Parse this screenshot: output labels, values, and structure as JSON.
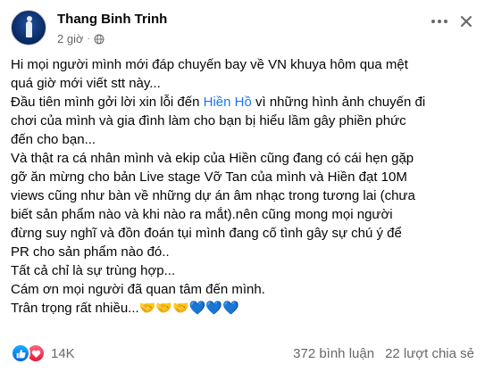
{
  "post": {
    "author": "Thang Binh Trinh",
    "time": "2 giờ",
    "separator": "·",
    "audience_icon": "globe-icon",
    "more_icon": "more-horizontal-icon",
    "close_icon": "close-icon",
    "lines": {
      "l1": "Hi mọi người mình mới đáp chuyến bay về VN khuya hôm qua mệt",
      "l2": "quá giờ mới viết stt này...",
      "l3a": "Đầu tiên mình gởi lời xin lỗi đến ",
      "mention": "Hiền Hồ",
      "l3b": " vì những hình ảnh chuyến đi",
      "l4": "chơi của mình và gia đình làm cho bạn bị hiểu lầm gây phiền phức",
      "l5": "đến cho bạn...",
      "l6": "Và thật ra cá nhân mình và ekip của Hiền cũng đang có cái hẹn gặp",
      "l7": "gỡ ăn mừng cho bản Live stage Vỡ Tan của mình và Hiền đạt 10M",
      "l8": "views cũng như bàn về những dự án âm nhạc trong tương lai (chưa",
      "l9": "biết sản phẩm nào và khi nào ra mắt).nên cũng mong mọi người",
      "l10": "đừng suy nghĩ và đồn đoán tụi mình đang cố tình gây sự chú ý để",
      "l11": "PR cho sản phẩm nào đó..",
      "l12": "Tất cả chỉ là sự trùng hợp...",
      "l13": "Cám ơn mọi người đã quan tâm đến mình.",
      "l14": "Trân trọng rất nhiều...",
      "l14_emoji_hands": "🤝🤝🤝",
      "l14_emoji_hearts": "💙💙💙"
    }
  },
  "footer": {
    "reaction_icons": [
      "like-icon",
      "love-icon"
    ],
    "reaction_count": "14K",
    "comments": "372 bình luận",
    "shares": "22 lượt chia sẻ"
  },
  "colors": {
    "text": "#050505",
    "secondary": "#65676b",
    "link": "#1877f2",
    "like": "#1877f2",
    "love": "#f33e58"
  }
}
